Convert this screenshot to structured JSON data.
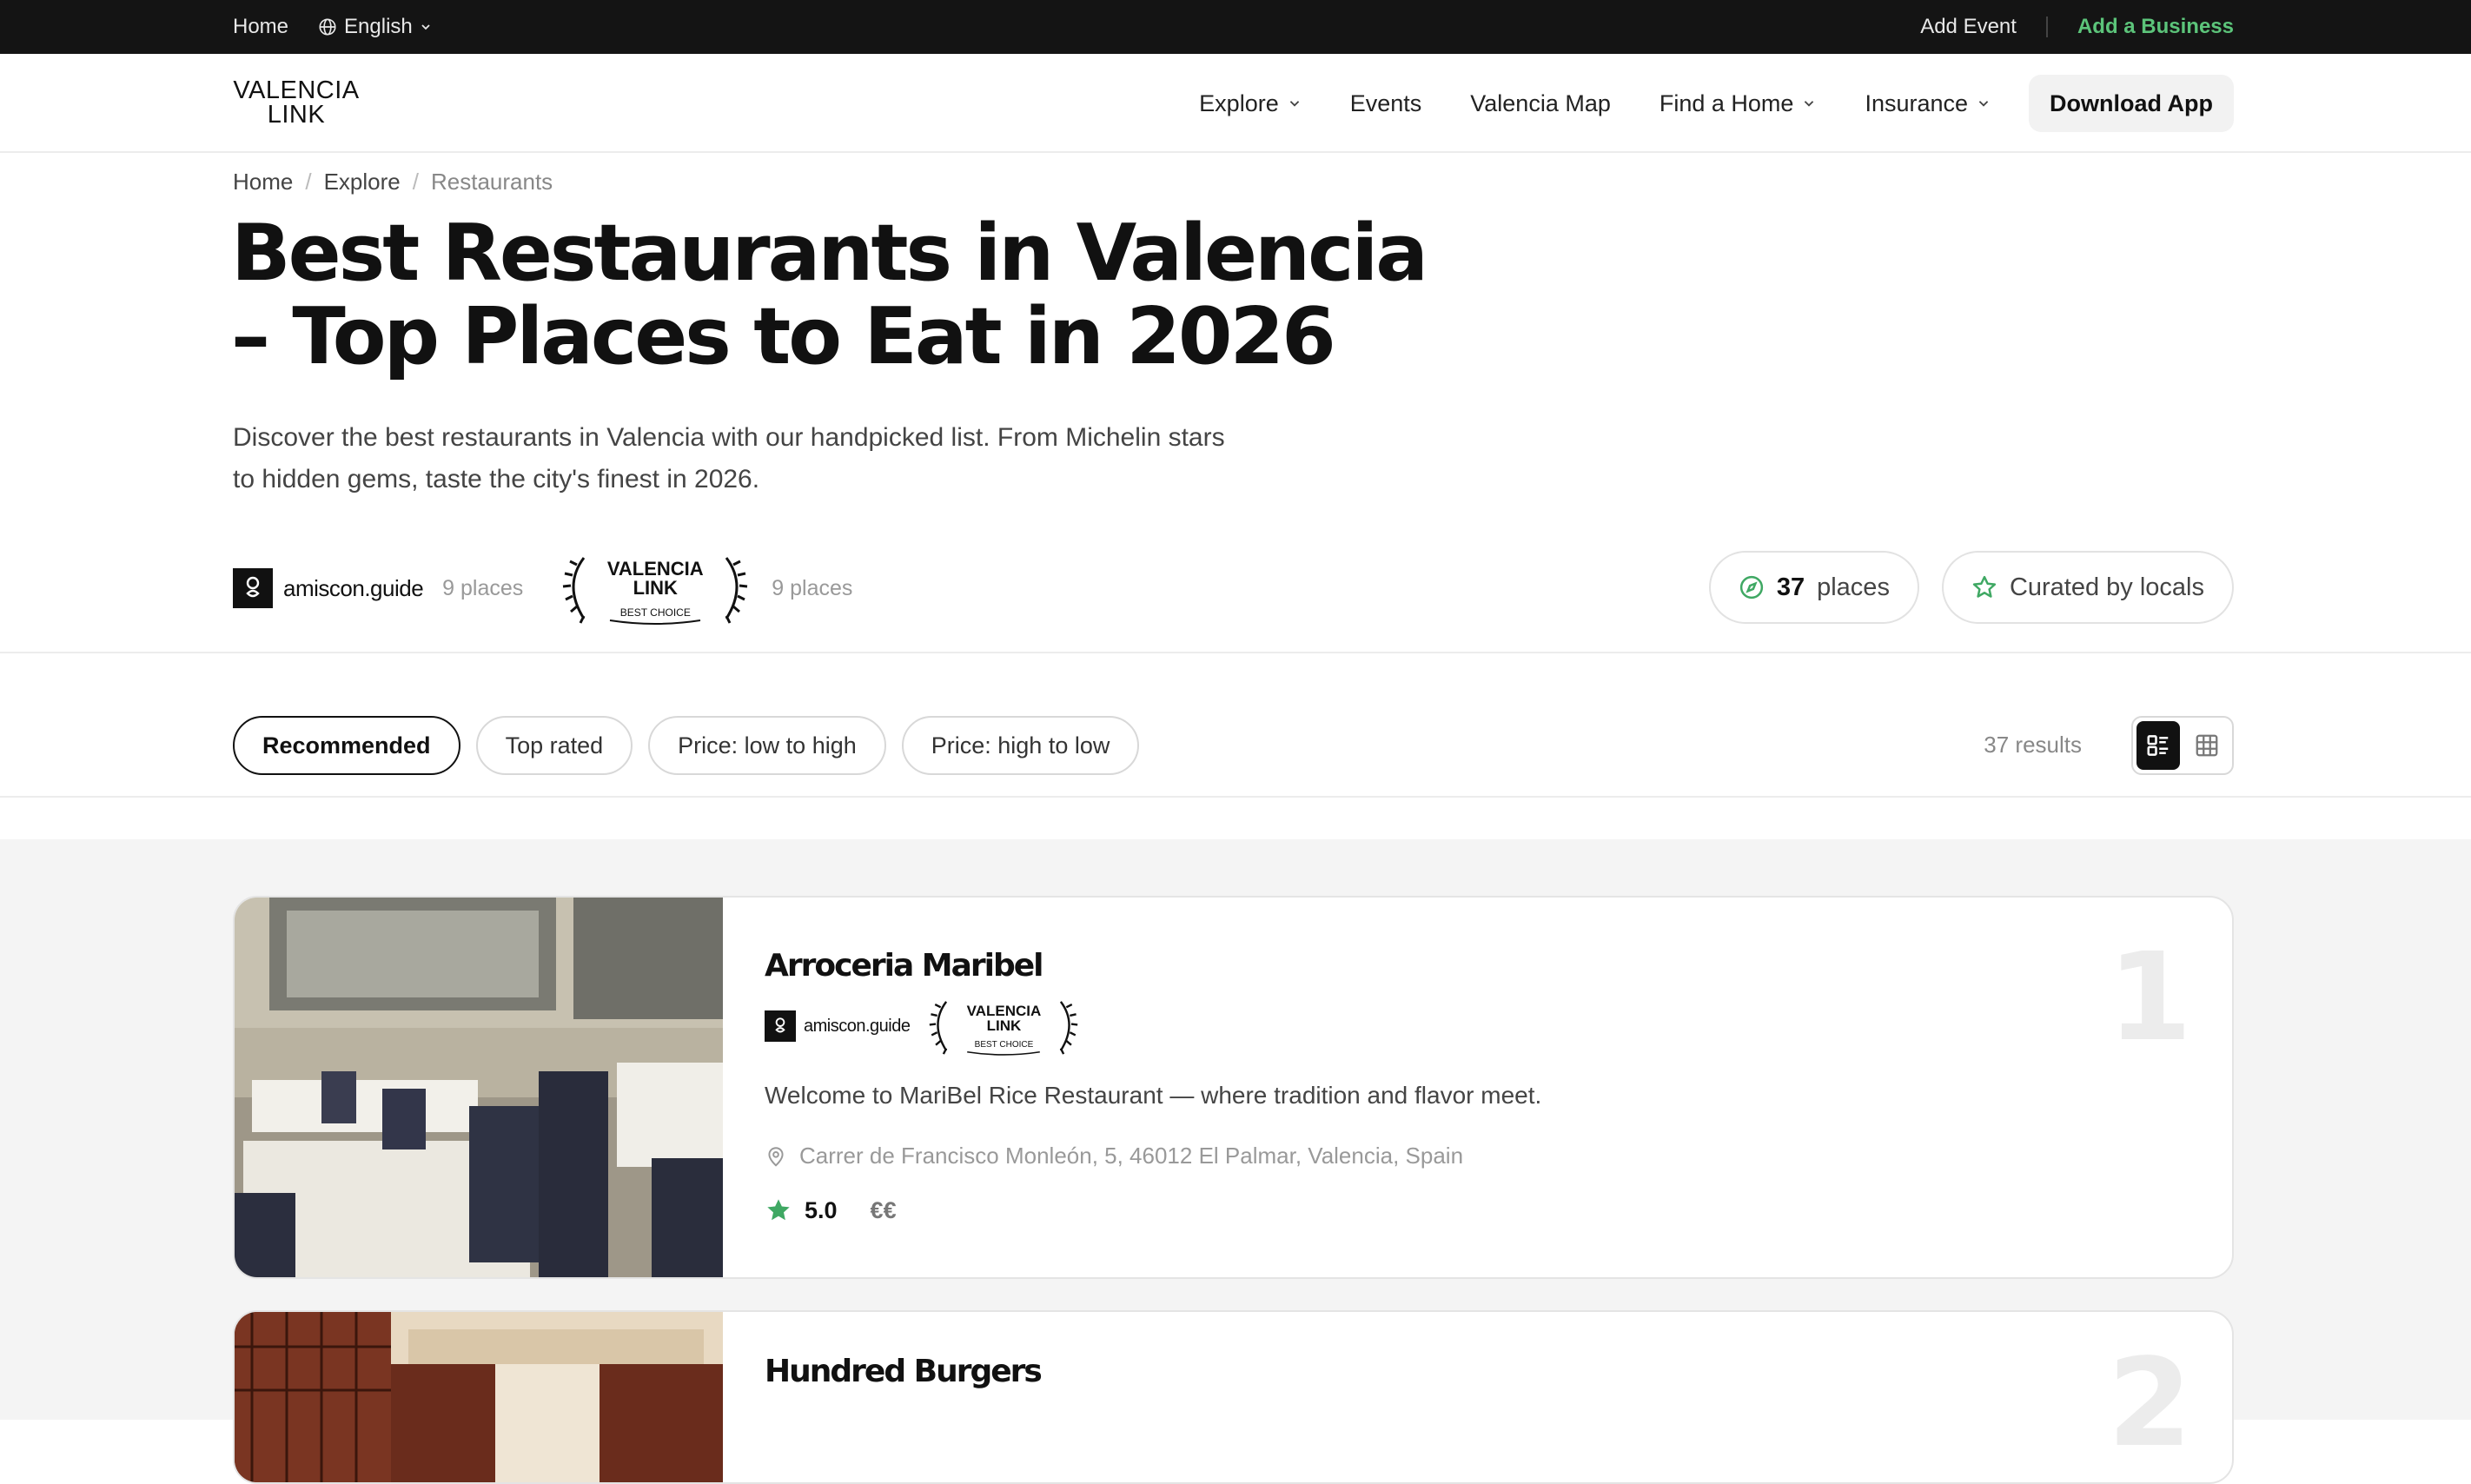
{
  "topbar": {
    "home": "Home",
    "language": "English",
    "add_event": "Add Event",
    "add_business": "Add a Business"
  },
  "brand": {
    "logo_line1": "VALENCIA",
    "logo_line2": "LINK"
  },
  "nav": {
    "items": [
      {
        "label": "Explore",
        "dropdown": true
      },
      {
        "label": "Events",
        "dropdown": false
      },
      {
        "label": "Valencia Map",
        "dropdown": false
      },
      {
        "label": "Find a Home",
        "dropdown": true
      },
      {
        "label": "Insurance",
        "dropdown": true
      }
    ],
    "download_label": "Download App"
  },
  "breadcrumb": {
    "home": "Home",
    "explore": "Explore",
    "current": "Restaurants"
  },
  "page": {
    "title": "Best Restaurants in Valencia – Top Places to Eat in 2026",
    "lead": "Discover the best restaurants in Valencia with our handpicked list. From Michelin stars to hidden gems, taste the city's finest in 2026."
  },
  "sources": {
    "amiscon_name": "amiscon.guide",
    "amiscon_count": "9 places",
    "vl_line1": "VALENCIA",
    "vl_line2": "LINK",
    "vl_line3": "BEST CHOICE",
    "vl_count": "9 places"
  },
  "stats": {
    "places_count": "37",
    "places_label": "places",
    "curated_label": "Curated by locals"
  },
  "filters": {
    "options": [
      "Recommended",
      "Top rated",
      "Price: low to high",
      "Price: high to low"
    ],
    "active": "Recommended",
    "results": "37 results",
    "view": "list"
  },
  "restaurants": [
    {
      "rank": "1",
      "name": "Arroceria Maribel",
      "description": "Welcome to MariBel Rice Restaurant — where tradition and flavor meet.",
      "address": "Carrer de Francisco Monleón, 5, 46012 El Palmar, Valencia, Spain",
      "rating": "5.0",
      "price": "€€"
    },
    {
      "rank": "2",
      "name": "Hundred Burgers"
    }
  ],
  "colors": {
    "accent_green": "#5cc47a",
    "star_green": "#3fa863",
    "topbar_bg": "#141414"
  }
}
